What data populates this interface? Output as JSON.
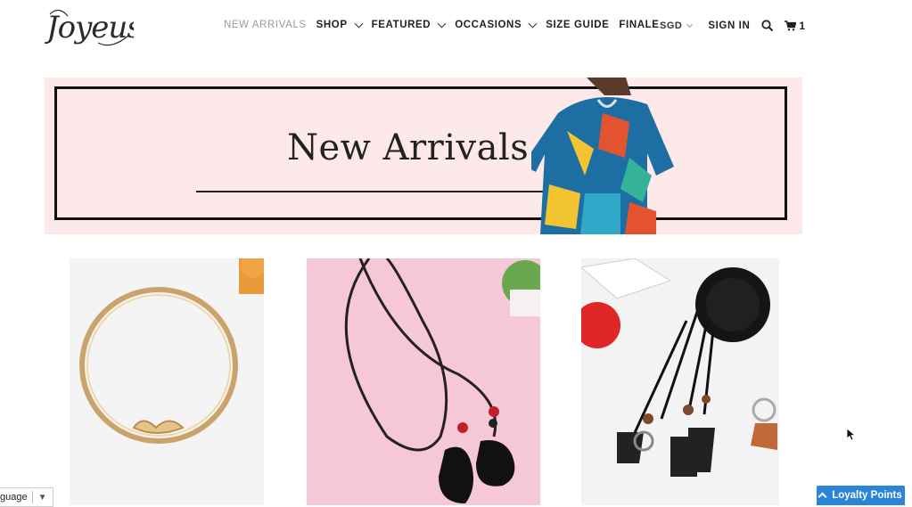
{
  "header": {
    "logo_text": "Joyeus",
    "nav": [
      {
        "label": "NEW ARRIVALS",
        "active": true,
        "dropdown": false
      },
      {
        "label": "SHOP",
        "active": false,
        "dropdown": true
      },
      {
        "label": "FEATURED",
        "active": false,
        "dropdown": true
      },
      {
        "label": "OCCASIONS",
        "active": false,
        "dropdown": true
      },
      {
        "label": "SIZE GUIDE",
        "active": false,
        "dropdown": false
      },
      {
        "label": "FINALE",
        "active": false,
        "dropdown": false
      }
    ],
    "currency": "SGD",
    "sign_in": "SIGN IN",
    "cart_count": "1",
    "icons": {
      "search": "search-icon",
      "cart": "cart-icon"
    }
  },
  "banner": {
    "title": "New Arrivals",
    "background": "#fde9e9"
  },
  "products": [
    {
      "name": "gold-belt",
      "image": "gold metal bangle belt"
    },
    {
      "name": "black-tassel-necklace",
      "image": "black cord necklace with fur tassels"
    },
    {
      "name": "black-braided-tassel-necklace",
      "image": "black braided tassel necklace"
    }
  ],
  "widgets": {
    "language_label": "guage",
    "language_arrow": "▼",
    "loyalty_label": "Loyalty Points",
    "loyalty_color": "#2a84d8"
  }
}
